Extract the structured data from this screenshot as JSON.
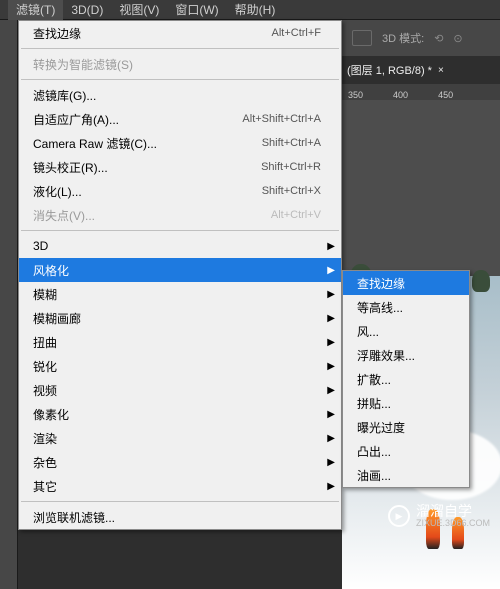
{
  "menubar": [
    {
      "label": "滤镜(T)",
      "active": true
    },
    {
      "label": "3D(D)"
    },
    {
      "label": "视图(V)"
    },
    {
      "label": "窗口(W)"
    },
    {
      "label": "帮助(H)"
    }
  ],
  "toolbar": {
    "mode_label": "3D 模式:"
  },
  "tab": {
    "title": "(图层 1, RGB/8) *"
  },
  "ruler": [
    "350",
    "400",
    "450"
  ],
  "menu": [
    {
      "label": "查找边缘",
      "shortcut": "Alt+Ctrl+F"
    },
    {
      "sep": true
    },
    {
      "label": "转换为智能滤镜(S)",
      "disabled": true
    },
    {
      "sep": true
    },
    {
      "label": "滤镜库(G)..."
    },
    {
      "label": "自适应广角(A)...",
      "shortcut": "Alt+Shift+Ctrl+A"
    },
    {
      "label": "Camera Raw 滤镜(C)...",
      "shortcut": "Shift+Ctrl+A"
    },
    {
      "label": "镜头校正(R)...",
      "shortcut": "Shift+Ctrl+R"
    },
    {
      "label": "液化(L)...",
      "shortcut": "Shift+Ctrl+X"
    },
    {
      "label": "消失点(V)...",
      "shortcut": "Alt+Ctrl+V",
      "disabled": true
    },
    {
      "sep": true
    },
    {
      "label": "3D",
      "submenu": true
    },
    {
      "label": "风格化",
      "submenu": true,
      "highlighted": true
    },
    {
      "label": "模糊",
      "submenu": true
    },
    {
      "label": "模糊画廊",
      "submenu": true
    },
    {
      "label": "扭曲",
      "submenu": true
    },
    {
      "label": "锐化",
      "submenu": true
    },
    {
      "label": "视频",
      "submenu": true
    },
    {
      "label": "像素化",
      "submenu": true
    },
    {
      "label": "渲染",
      "submenu": true
    },
    {
      "label": "杂色",
      "submenu": true
    },
    {
      "label": "其它",
      "submenu": true
    },
    {
      "sep": true
    },
    {
      "label": "浏览联机滤镜..."
    }
  ],
  "submenu": [
    {
      "label": "查找边缘",
      "highlighted": true
    },
    {
      "label": "等高线..."
    },
    {
      "label": "风..."
    },
    {
      "label": "浮雕效果..."
    },
    {
      "label": "扩散..."
    },
    {
      "label": "拼贴..."
    },
    {
      "label": "曝光过度"
    },
    {
      "label": "凸出..."
    },
    {
      "label": "油画..."
    }
  ],
  "watermark": {
    "title": "溜溜自学",
    "sub": "ZIXUE.3D66.COM"
  }
}
